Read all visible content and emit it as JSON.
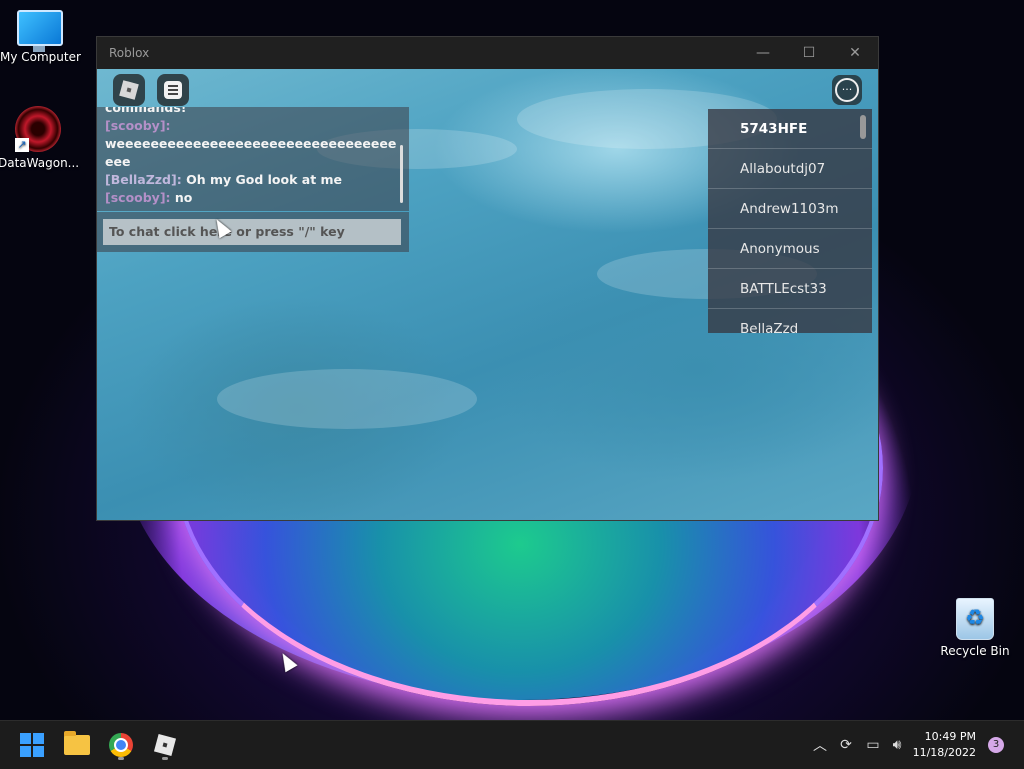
{
  "desktop": {
    "icons": [
      {
        "label": "My Computer",
        "icon": "monitor-icon"
      },
      {
        "label": "DataWagon...",
        "icon": "datawagon-icon"
      },
      {
        "label": "Recycle Bin",
        "icon": "recycle-bin-icon"
      }
    ]
  },
  "window": {
    "title": "Roblox",
    "controls": {
      "minimize": "—",
      "maximize": "☐",
      "close": "✕"
    }
  },
  "chat": {
    "messages": [
      {
        "user": "",
        "text": "commands!"
      },
      {
        "user": "[scooby]:",
        "text": "weeeeeeeeeeeeeeeeeeeeeeeeeeeeeeeeeeee"
      },
      {
        "user": "[BellaZzd]:",
        "text": "Oh my God look at me"
      },
      {
        "user": "[scooby]:",
        "text": "no"
      }
    ],
    "input_placeholder": "To chat click here or press \"/\" key"
  },
  "players": {
    "list": [
      "5743HFE",
      "Allaboutdj07",
      "Andrew1103m",
      "Anonymous",
      "BATTLEcst33",
      "BellaZzd"
    ]
  },
  "taskbar": {
    "apps": [
      "start-icon",
      "file-explorer-icon",
      "chrome-icon",
      "roblox-icon"
    ],
    "clock_time": "10:49 PM",
    "clock_date": "11/18/2022",
    "notification_count": "3"
  }
}
